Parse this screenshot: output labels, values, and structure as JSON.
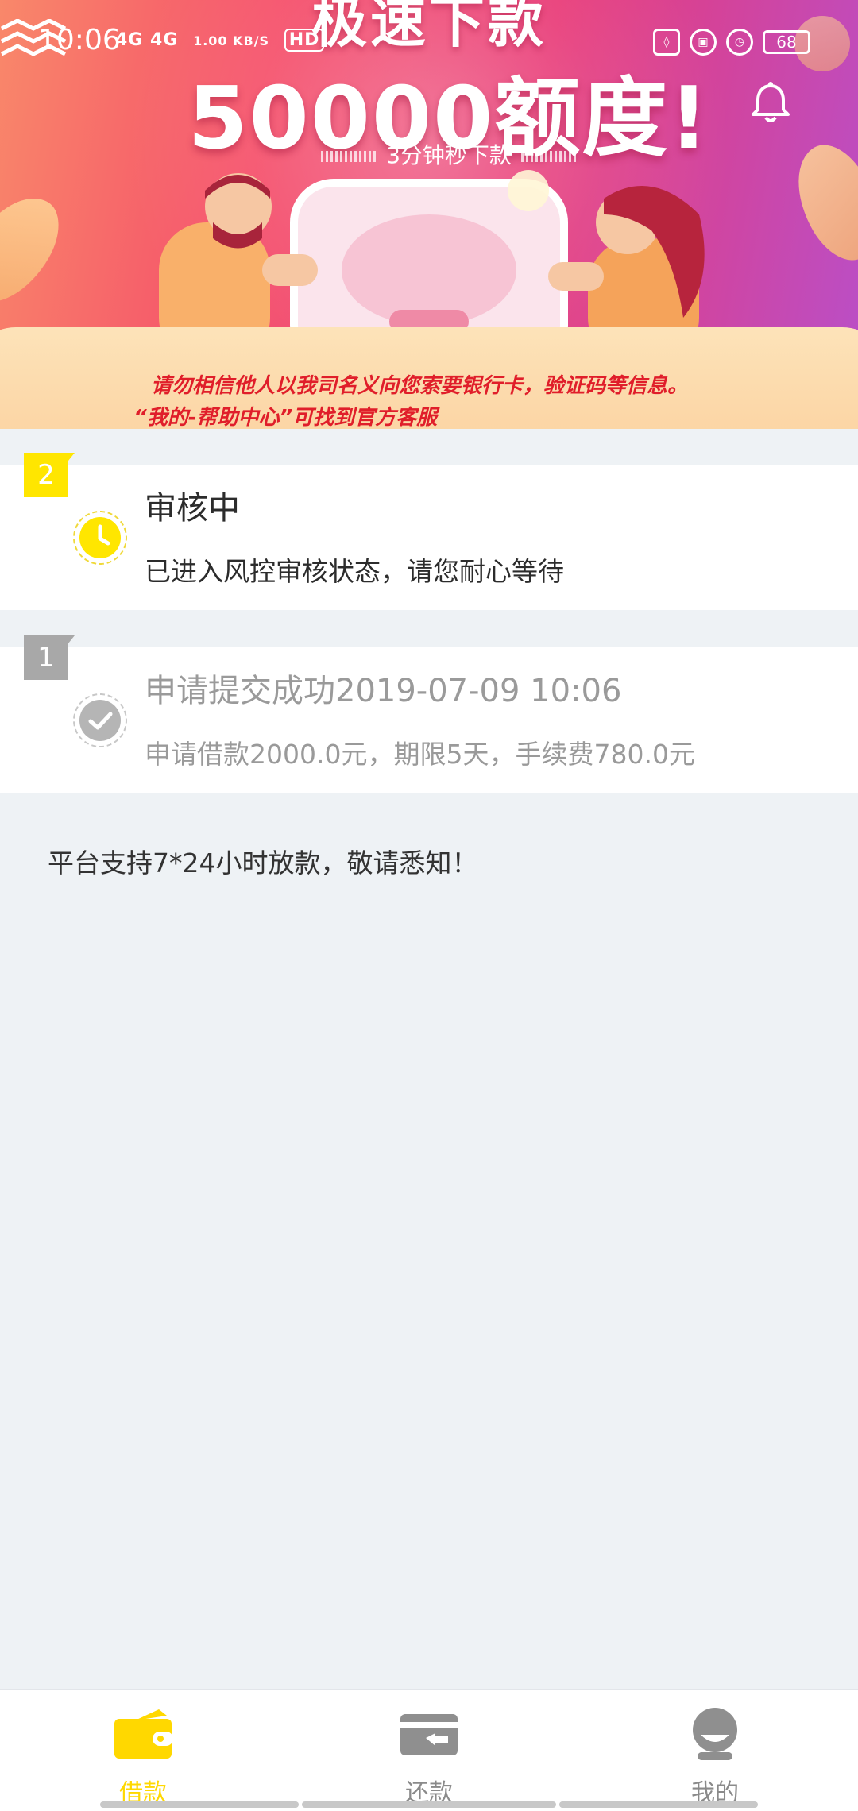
{
  "status_bar": {
    "time": "10:06",
    "network": "4G 4G",
    "speed": "1.00 KB/S",
    "hd": "HD",
    "battery": "68"
  },
  "banner": {
    "headline_top": "极速下款",
    "headline_main": "50000额度!",
    "subline": "3分钟秒下款",
    "warning_line1": "请勿相信他人以我司名义向您索要银行卡，验证码等信息。",
    "warning_line2": "“我的-帮助中心”可找到官方客服"
  },
  "steps": [
    {
      "badge": "2",
      "title": "审核中",
      "desc": "已进入风控审核状态，请您耐心等待",
      "state": "active",
      "icon": "clock-icon"
    },
    {
      "badge": "1",
      "title": "申请提交成功2019-07-09 10:06",
      "desc": "申请借款2000.0元，期限5天，手续费780.0元",
      "state": "done",
      "icon": "check-icon"
    }
  ],
  "notice": "平台支持7*24小时放款，敬请悉知！",
  "bottom_nav": {
    "borrow": "借款",
    "repay": "还款",
    "mine": "我的"
  },
  "colors": {
    "accent_yellow": "#ffe600",
    "done_gray": "#a8a8a8",
    "warning_red": "#e01e2a",
    "background": "#eef2f5"
  }
}
